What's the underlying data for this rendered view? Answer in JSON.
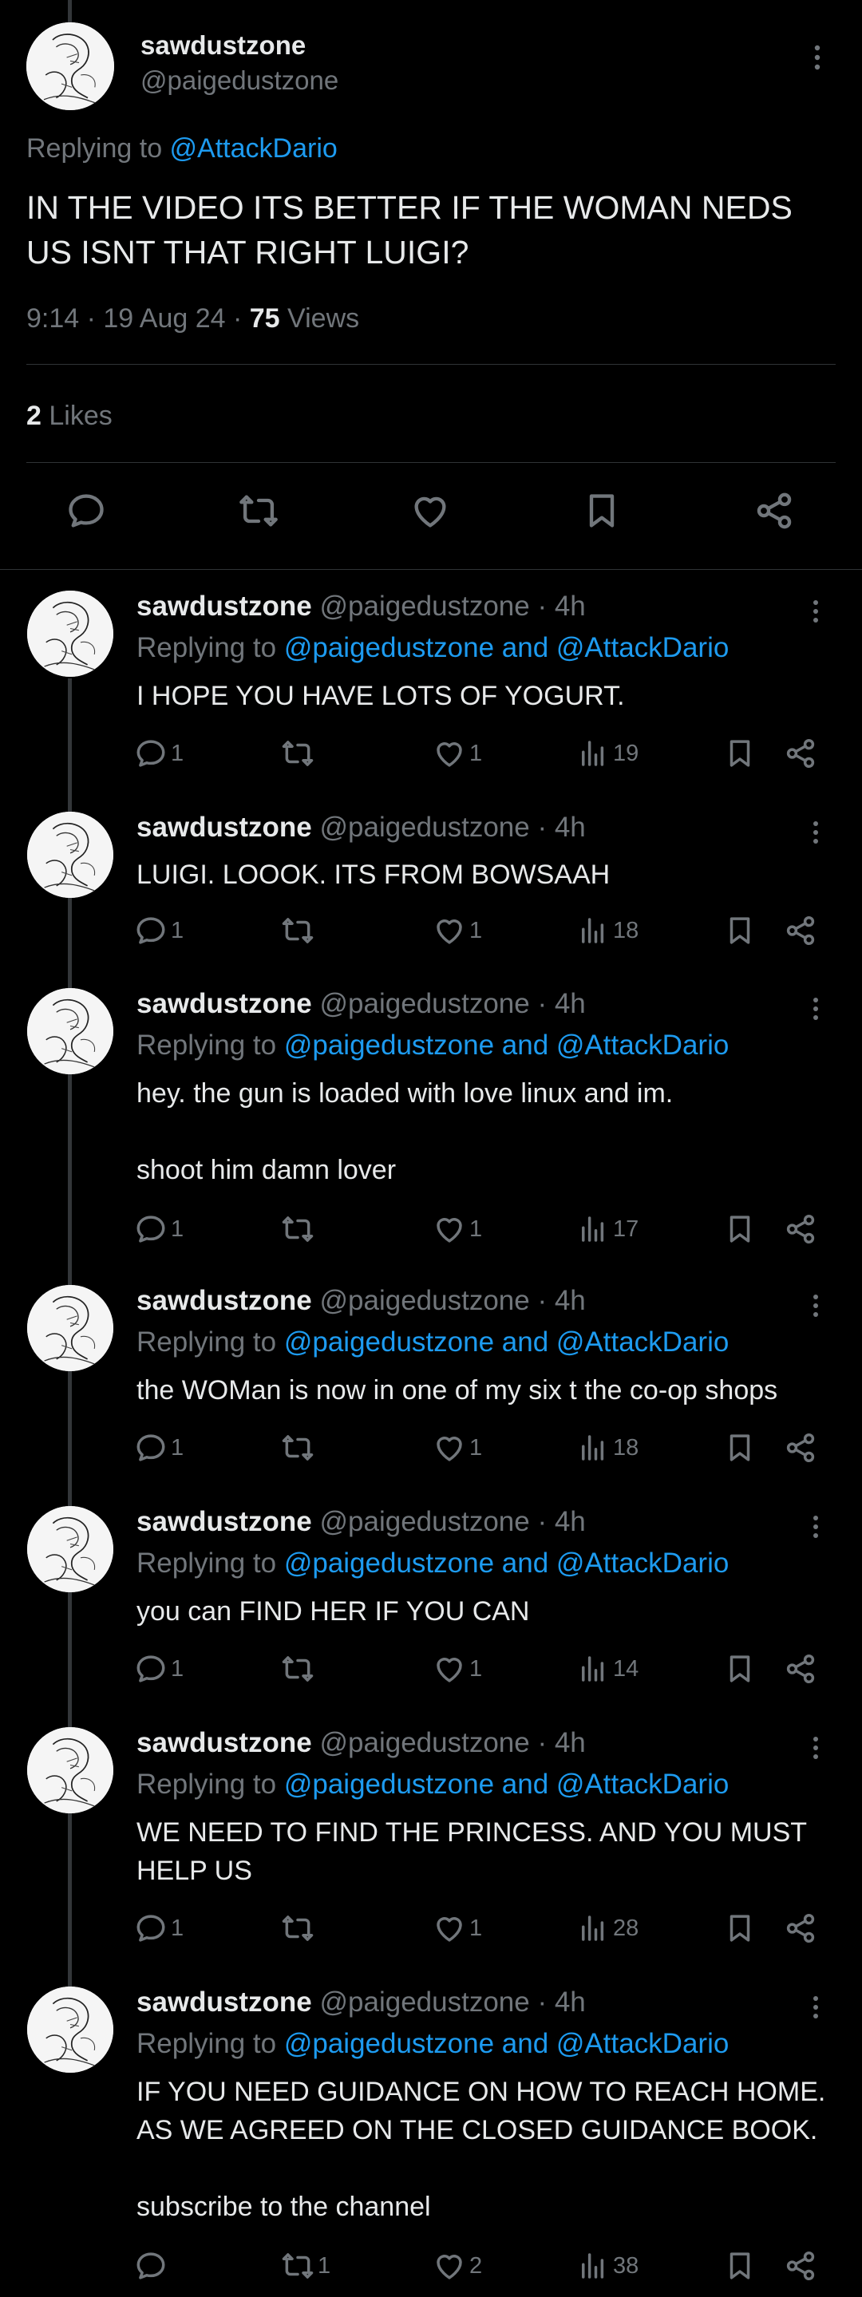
{
  "main": {
    "name": "sawdustzone",
    "handle": "@paigedustzone",
    "replying_prefix": "Replying to ",
    "replying_to": "@AttackDario",
    "text": "IN THE VIDEO ITS BETTER IF THE WOMAN NEDS US ISNT THAT RIGHT LUIGI?",
    "time": "9:14 · 19 Aug 24 · ",
    "views_count": "75",
    "views_label": " Views",
    "likes_count": "2",
    "likes_label": " Likes",
    "actions": [
      "reply-icon",
      "retweet-icon",
      "like-icon",
      "bookmark-icon",
      "share-icon"
    ]
  },
  "replies": [
    {
      "name": "sawdustzone",
      "handle": "@paigedustzone · 4h",
      "replying_prefix": "Replying to ",
      "replying_to": "@paigedustzone and @AttackDario",
      "text": "I HOPE YOU HAVE LOTS OF YOGURT.",
      "replies": "1",
      "retweets": "",
      "likes": "1",
      "views": "19"
    },
    {
      "name": "sawdustzone",
      "handle": "@paigedustzone · 4h",
      "replying_prefix": "",
      "replying_to": "",
      "text": "LUIGI. LOOOK. ITS FROM BOWSAAH",
      "replies": "1",
      "retweets": "",
      "likes": "1",
      "views": "18"
    },
    {
      "name": "sawdustzone",
      "handle": "@paigedustzone · 4h",
      "replying_prefix": "Replying to ",
      "replying_to": "@paigedustzone and @AttackDario",
      "text": "hey. the gun is loaded with love linux and im.\n\nshoot him damn lover",
      "replies": "1",
      "retweets": "",
      "likes": "1",
      "views": "17"
    },
    {
      "name": "sawdustzone",
      "handle": "@paigedustzone · 4h",
      "replying_prefix": "Replying to ",
      "replying_to": "@paigedustzone and @AttackDario",
      "text": "the WOMan is now in one of my six t the co-op shops",
      "replies": "1",
      "retweets": "",
      "likes": "1",
      "views": "18"
    },
    {
      "name": "sawdustzone",
      "handle": "@paigedustzone · 4h",
      "replying_prefix": "Replying to ",
      "replying_to": "@paigedustzone and @AttackDario",
      "text": "you can FIND HER IF YOU CAN",
      "replies": "1",
      "retweets": "",
      "likes": "1",
      "views": "14"
    },
    {
      "name": "sawdustzone",
      "handle": "@paigedustzone · 4h",
      "replying_prefix": "Replying to ",
      "replying_to": "@paigedustzone and @AttackDario",
      "text": "WE NEED TO FIND THE PRINCESS. AND YOU MUST HELP US",
      "replies": "1",
      "retweets": "",
      "likes": "1",
      "views": "28"
    },
    {
      "name": "sawdustzone",
      "handle": "@paigedustzone · 4h",
      "replying_prefix": "Replying to ",
      "replying_to": "@paigedustzone and @AttackDario",
      "text": "IF YOU NEED GUIDANCE ON HOW TO REACH HOME. AS WE AGREED ON THE CLOSED GUIDANCE BOOK.\n\nsubscribe to the channel",
      "replies": "",
      "retweets": "1",
      "likes": "2",
      "views": "38"
    }
  ],
  "colors": {
    "background": "#000000",
    "text": "#e7e9ea",
    "muted": "#71767b",
    "link": "#1d9bf0",
    "divider": "#2f3336"
  }
}
